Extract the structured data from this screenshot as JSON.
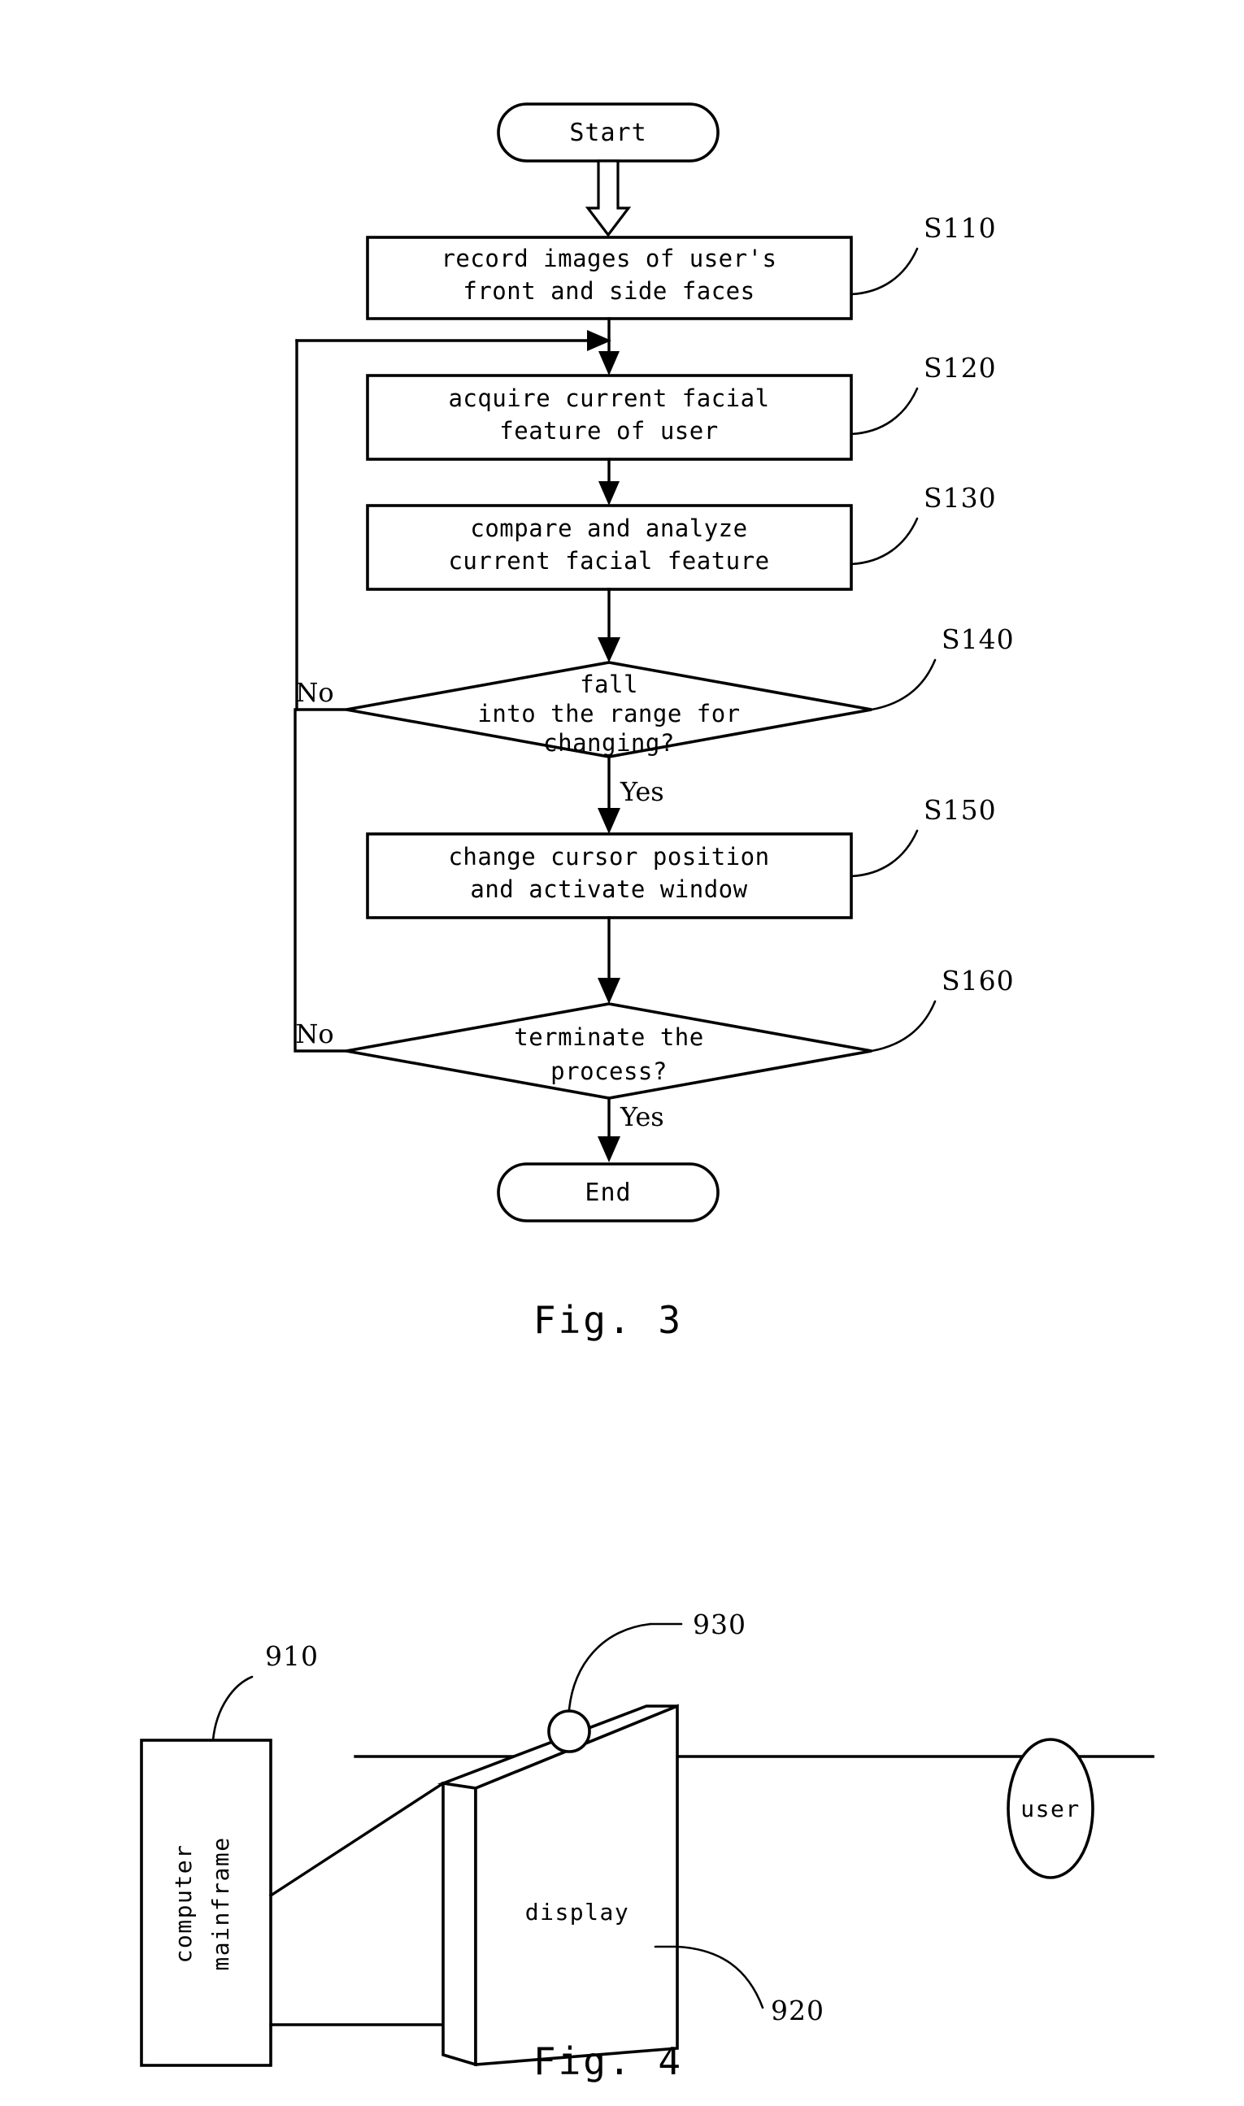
{
  "document": {
    "type": "patent-drawing-sheet",
    "figures": [
      "Fig. 3",
      "Fig. 4"
    ]
  },
  "fig3": {
    "caption": "Fig. 3",
    "terminals": {
      "start": "Start",
      "end": "End"
    },
    "steps": [
      {
        "ref": "S110",
        "lines": [
          "record images of user's",
          "front and side faces"
        ]
      },
      {
        "ref": "S120",
        "lines": [
          "acquire current facial",
          "feature of user"
        ]
      },
      {
        "ref": "S130",
        "lines": [
          "compare and analyze",
          "current facial feature"
        ]
      },
      {
        "ref": "S150",
        "lines": [
          "change cursor position",
          "and activate window"
        ]
      }
    ],
    "decisions": [
      {
        "ref": "S140",
        "lines": [
          "fall",
          "into the range for",
          "changing?"
        ],
        "no_label": "No",
        "yes_label": "Yes"
      },
      {
        "ref": "S160",
        "lines": [
          "terminate the",
          "process?"
        ],
        "no_label": "No",
        "yes_label": "Yes"
      }
    ]
  },
  "fig4": {
    "caption": "Fig. 4",
    "labels": {
      "mainframe": "computer mainframe",
      "display": "display",
      "user": "user"
    },
    "refs": {
      "mainframe": "910",
      "display": "920",
      "camera": "930"
    }
  },
  "colors": {
    "ink": "#000000",
    "paper": "#ffffff"
  }
}
